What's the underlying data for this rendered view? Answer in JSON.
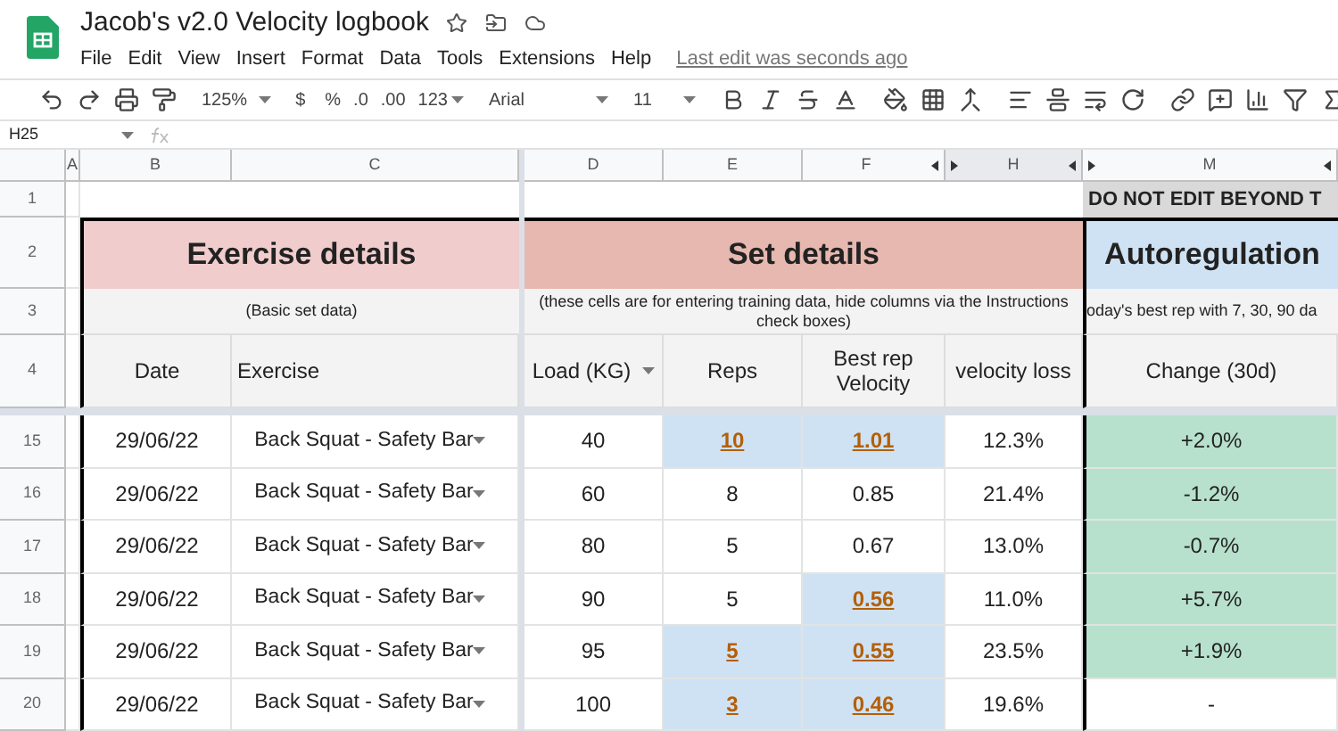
{
  "doc": {
    "title": "Jacob's v2.0 Velocity logbook",
    "menus": [
      "File",
      "Edit",
      "View",
      "Insert",
      "Format",
      "Data",
      "Tools",
      "Extensions",
      "Help"
    ],
    "last_edit": "Last edit was seconds ago"
  },
  "toolbar": {
    "zoom": "125%",
    "currency": "$",
    "percent": "%",
    "dec_less": ".0",
    "dec_more": ".00",
    "format": "123",
    "font": "Arial",
    "size": "11"
  },
  "name_box": "H25",
  "columns": [
    "A",
    "B",
    "C",
    "D",
    "E",
    "F",
    "H",
    "M"
  ],
  "row1": {
    "row": "1",
    "warning": "DO NOT EDIT BEYOND T"
  },
  "row2": {
    "row": "2",
    "sections": [
      "Exercise details",
      "Set details",
      "Autoregulation"
    ]
  },
  "row3": {
    "row": "3",
    "notes": [
      "(Basic set data)",
      "(these cells are for entering training data, hide columns via the Instructions check boxes)",
      "oday's best rep with 7, 30, 90 da"
    ]
  },
  "row4": {
    "row": "4",
    "headers": [
      "Date",
      "Exercise",
      "Load (KG)",
      "Reps",
      "Best rep Velocity",
      "velocity loss",
      "Change (30d)"
    ]
  },
  "rows": [
    {
      "row": "15",
      "date": "29/06/22",
      "exercise": "Back Squat - Safety Bar",
      "load": "40",
      "reps": {
        "text": "10",
        "highlighted": true
      },
      "velocity": {
        "text": "1.01",
        "highlighted": true
      },
      "loss": "12.3%",
      "change": {
        "text": "+2.0%",
        "highlighted": true
      }
    },
    {
      "row": "16",
      "date": "29/06/22",
      "exercise": "Back Squat - Safety Bar",
      "load": "60",
      "reps": {
        "text": "8",
        "highlighted": false
      },
      "velocity": {
        "text": "0.85",
        "highlighted": false
      },
      "loss": "21.4%",
      "change": {
        "text": "-1.2%",
        "highlighted": true
      }
    },
    {
      "row": "17",
      "date": "29/06/22",
      "exercise": "Back Squat - Safety Bar",
      "load": "80",
      "reps": {
        "text": "5",
        "highlighted": false
      },
      "velocity": {
        "text": "0.67",
        "highlighted": false
      },
      "loss": "13.0%",
      "change": {
        "text": "-0.7%",
        "highlighted": true
      }
    },
    {
      "row": "18",
      "date": "29/06/22",
      "exercise": "Back Squat - Safety Bar",
      "load": "90",
      "reps": {
        "text": "5",
        "highlighted": false
      },
      "velocity": {
        "text": "0.56",
        "highlighted": true
      },
      "loss": "11.0%",
      "change": {
        "text": "+5.7%",
        "highlighted": true
      }
    },
    {
      "row": "19",
      "date": "29/06/22",
      "exercise": "Back Squat - Safety Bar",
      "load": "95",
      "reps": {
        "text": "5",
        "highlighted": true
      },
      "velocity": {
        "text": "0.55",
        "highlighted": true
      },
      "loss": "23.5%",
      "change": {
        "text": "+1.9%",
        "highlighted": true
      }
    },
    {
      "row": "20",
      "date": "29/06/22",
      "exercise": "Back Squat - Safety Bar",
      "load": "100",
      "reps": {
        "text": "3",
        "highlighted": true
      },
      "velocity": {
        "text": "0.46",
        "highlighted": true
      },
      "loss": "19.6%",
      "change": {
        "text": "-",
        "highlighted": false
      }
    }
  ]
}
